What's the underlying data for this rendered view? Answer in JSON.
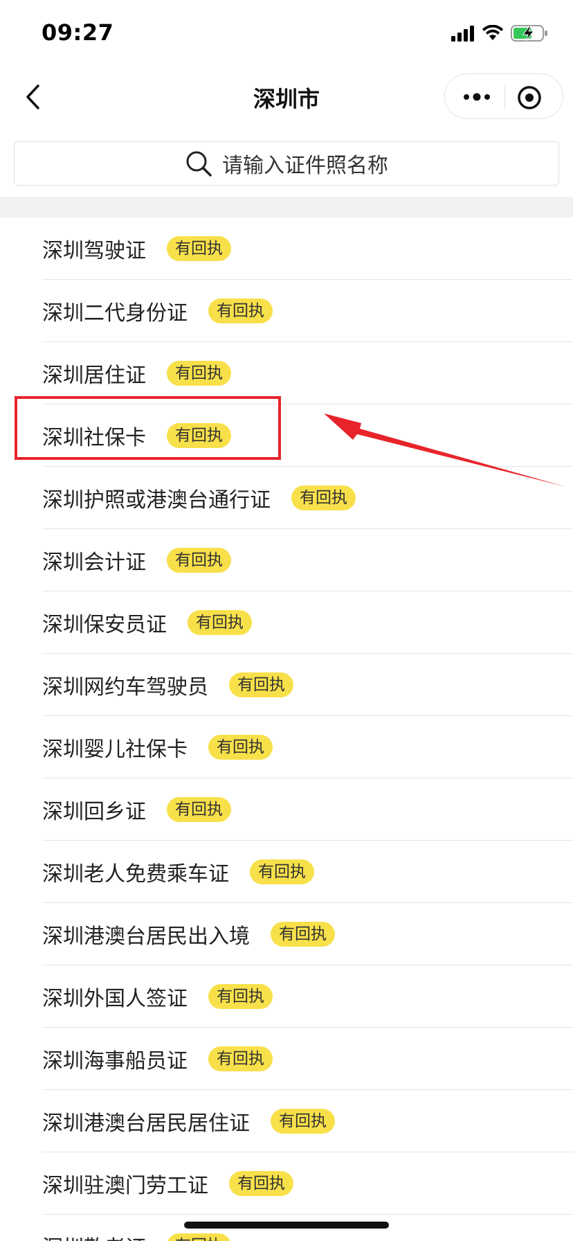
{
  "status_bar": {
    "time": "09:27"
  },
  "nav": {
    "title": "深圳市"
  },
  "search": {
    "placeholder": "请输入证件照名称"
  },
  "colors": {
    "badge": "#f8e04a",
    "highlight": "#e8242b"
  },
  "list": {
    "badge_label": "有回执",
    "items": [
      {
        "label": "深圳驾驶证"
      },
      {
        "label": "深圳二代身份证"
      },
      {
        "label": "深圳居住证"
      },
      {
        "label": "深圳社保卡"
      },
      {
        "label": "深圳护照或港澳台通行证"
      },
      {
        "label": "深圳会计证"
      },
      {
        "label": "深圳保安员证"
      },
      {
        "label": "深圳网约车驾驶员"
      },
      {
        "label": "深圳婴儿社保卡"
      },
      {
        "label": "深圳回乡证"
      },
      {
        "label": "深圳老人免费乘车证"
      },
      {
        "label": "深圳港澳台居民出入境"
      },
      {
        "label": "深圳外国人签证"
      },
      {
        "label": "深圳海事船员证"
      },
      {
        "label": "深圳港澳台居民居住证"
      },
      {
        "label": "深圳驻澳门劳工证"
      },
      {
        "label": "深圳敬老证"
      }
    ]
  }
}
